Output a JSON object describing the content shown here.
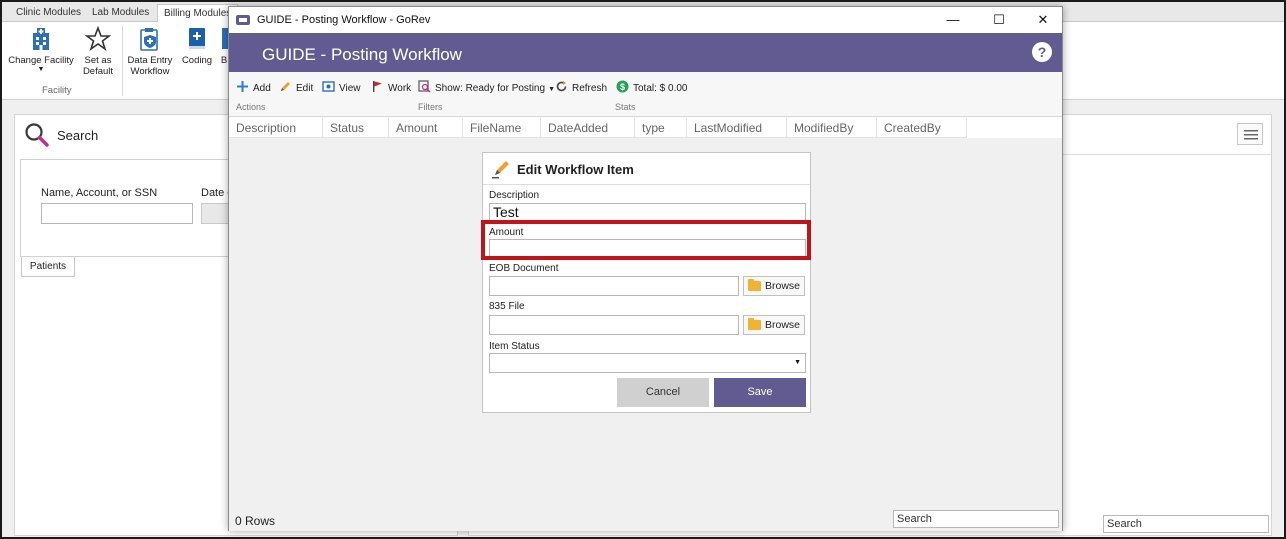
{
  "app_tabs": [
    "Clinic Modules",
    "Lab Modules",
    "Billing Modules"
  ],
  "ribbon": {
    "change_facility": "Change Facility",
    "set_default_1": "Set as",
    "set_default_2": "Default",
    "group_facility": "Facility",
    "data_entry_1": "Data Entry",
    "data_entry_2": "Workflow",
    "coding": "Coding",
    "partial": "B"
  },
  "search_panel": {
    "title": "Search",
    "name_label": "Name, Account, or SSN",
    "date_label": "Date o",
    "patients_tab": "Patients",
    "bottom_search": "Search"
  },
  "window": {
    "title": "GUIDE - Posting Workflow - GoRev",
    "header": "GUIDE - Posting Workflow",
    "help": "?",
    "minimize": "—",
    "maximize": "☐",
    "close": "✕"
  },
  "toolbar": {
    "add": "Add",
    "edit": "Edit",
    "view": "View",
    "work": "Work",
    "show": "Show: Ready for Posting",
    "refresh": "Refresh",
    "total": "Total: $ 0.00",
    "group_actions": "Actions",
    "group_filters": "Filters",
    "group_stats": "Stats"
  },
  "grid": {
    "columns": [
      "Description",
      "Status",
      "Amount",
      "FileName",
      "DateAdded",
      "type",
      "LastModified",
      "ModifiedBy",
      "CreatedBy"
    ]
  },
  "form": {
    "title": "Edit Workflow Item",
    "description_label": "Description",
    "description_value": "Test",
    "amount_label": "Amount",
    "amount_value": "",
    "eob_label": "EOB Document",
    "file835_label": "835 File",
    "browse": "Browse",
    "status_label": "Item Status",
    "cancel": "Cancel",
    "save": "Save"
  },
  "status": {
    "rows": "0 Rows",
    "search": "Search"
  },
  "colors": {
    "purple": "#625b92",
    "highlight": "#c0141c",
    "save_bg": "#625b92",
    "cancel_bg": "#d0d0d0"
  }
}
